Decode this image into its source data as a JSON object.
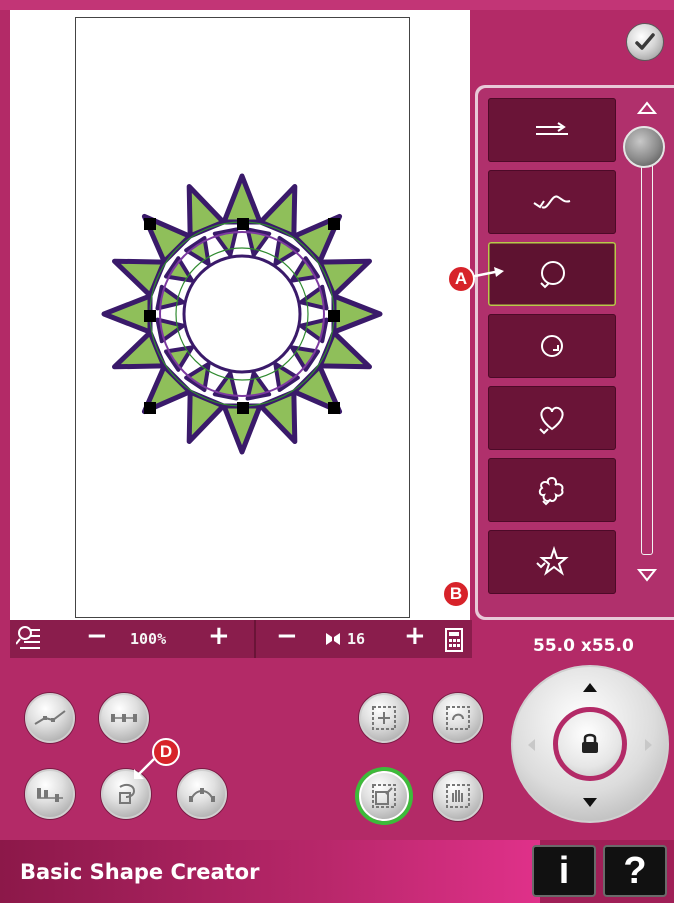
{
  "app": {
    "title": "Basic Shape Creator"
  },
  "toolbar": {
    "zoom_value": "100%",
    "minus_label": "−",
    "plus_label": "+",
    "repeat_count": "16"
  },
  "dimensions": {
    "text": "55.0 x55.0"
  },
  "stitch_list": {
    "items": [
      {
        "name": "straight-stitch",
        "icon": "arrows-line-icon"
      },
      {
        "name": "wave-stitch",
        "icon": "wave-stitch-icon"
      },
      {
        "name": "circle-shape",
        "icon": "circle-loop-icon",
        "selected": true
      },
      {
        "name": "small-circle-shape",
        "icon": "circle-small-icon"
      },
      {
        "name": "heart-shape",
        "icon": "heart-icon"
      },
      {
        "name": "flower-shape",
        "icon": "flower-icon"
      },
      {
        "name": "star-shape",
        "icon": "star-icon"
      }
    ]
  },
  "callouts": {
    "a": "A",
    "b": "B",
    "d": "D"
  },
  "footer": {
    "info_label": "i",
    "help_label": "?"
  },
  "colors": {
    "frame": "#b32a67",
    "panel": "#6a1437",
    "selected_border": "#b8c94a",
    "active_ring": "#3dbb3a",
    "callout": "#d7232a"
  }
}
